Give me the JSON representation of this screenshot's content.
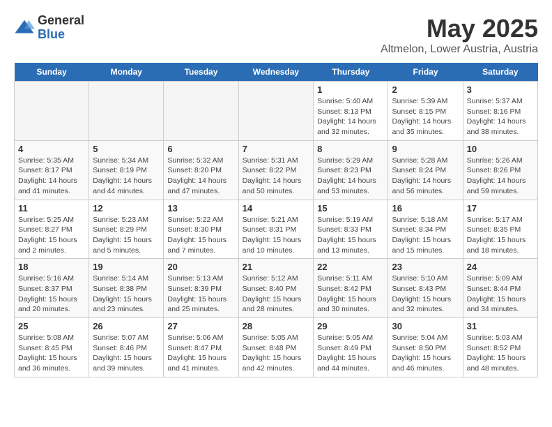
{
  "logo": {
    "general": "General",
    "blue": "Blue"
  },
  "title": "May 2025",
  "subtitle": "Altmelon, Lower Austria, Austria",
  "headers": [
    "Sunday",
    "Monday",
    "Tuesday",
    "Wednesday",
    "Thursday",
    "Friday",
    "Saturday"
  ],
  "weeks": [
    [
      {
        "day": "",
        "info": ""
      },
      {
        "day": "",
        "info": ""
      },
      {
        "day": "",
        "info": ""
      },
      {
        "day": "",
        "info": ""
      },
      {
        "day": "1",
        "info": "Sunrise: 5:40 AM\nSunset: 8:13 PM\nDaylight: 14 hours\nand 32 minutes."
      },
      {
        "day": "2",
        "info": "Sunrise: 5:39 AM\nSunset: 8:15 PM\nDaylight: 14 hours\nand 35 minutes."
      },
      {
        "day": "3",
        "info": "Sunrise: 5:37 AM\nSunset: 8:16 PM\nDaylight: 14 hours\nand 38 minutes."
      }
    ],
    [
      {
        "day": "4",
        "info": "Sunrise: 5:35 AM\nSunset: 8:17 PM\nDaylight: 14 hours\nand 41 minutes."
      },
      {
        "day": "5",
        "info": "Sunrise: 5:34 AM\nSunset: 8:19 PM\nDaylight: 14 hours\nand 44 minutes."
      },
      {
        "day": "6",
        "info": "Sunrise: 5:32 AM\nSunset: 8:20 PM\nDaylight: 14 hours\nand 47 minutes."
      },
      {
        "day": "7",
        "info": "Sunrise: 5:31 AM\nSunset: 8:22 PM\nDaylight: 14 hours\nand 50 minutes."
      },
      {
        "day": "8",
        "info": "Sunrise: 5:29 AM\nSunset: 8:23 PM\nDaylight: 14 hours\nand 53 minutes."
      },
      {
        "day": "9",
        "info": "Sunrise: 5:28 AM\nSunset: 8:24 PM\nDaylight: 14 hours\nand 56 minutes."
      },
      {
        "day": "10",
        "info": "Sunrise: 5:26 AM\nSunset: 8:26 PM\nDaylight: 14 hours\nand 59 minutes."
      }
    ],
    [
      {
        "day": "11",
        "info": "Sunrise: 5:25 AM\nSunset: 8:27 PM\nDaylight: 15 hours\nand 2 minutes."
      },
      {
        "day": "12",
        "info": "Sunrise: 5:23 AM\nSunset: 8:29 PM\nDaylight: 15 hours\nand 5 minutes."
      },
      {
        "day": "13",
        "info": "Sunrise: 5:22 AM\nSunset: 8:30 PM\nDaylight: 15 hours\nand 7 minutes."
      },
      {
        "day": "14",
        "info": "Sunrise: 5:21 AM\nSunset: 8:31 PM\nDaylight: 15 hours\nand 10 minutes."
      },
      {
        "day": "15",
        "info": "Sunrise: 5:19 AM\nSunset: 8:33 PM\nDaylight: 15 hours\nand 13 minutes."
      },
      {
        "day": "16",
        "info": "Sunrise: 5:18 AM\nSunset: 8:34 PM\nDaylight: 15 hours\nand 15 minutes."
      },
      {
        "day": "17",
        "info": "Sunrise: 5:17 AM\nSunset: 8:35 PM\nDaylight: 15 hours\nand 18 minutes."
      }
    ],
    [
      {
        "day": "18",
        "info": "Sunrise: 5:16 AM\nSunset: 8:37 PM\nDaylight: 15 hours\nand 20 minutes."
      },
      {
        "day": "19",
        "info": "Sunrise: 5:14 AM\nSunset: 8:38 PM\nDaylight: 15 hours\nand 23 minutes."
      },
      {
        "day": "20",
        "info": "Sunrise: 5:13 AM\nSunset: 8:39 PM\nDaylight: 15 hours\nand 25 minutes."
      },
      {
        "day": "21",
        "info": "Sunrise: 5:12 AM\nSunset: 8:40 PM\nDaylight: 15 hours\nand 28 minutes."
      },
      {
        "day": "22",
        "info": "Sunrise: 5:11 AM\nSunset: 8:42 PM\nDaylight: 15 hours\nand 30 minutes."
      },
      {
        "day": "23",
        "info": "Sunrise: 5:10 AM\nSunset: 8:43 PM\nDaylight: 15 hours\nand 32 minutes."
      },
      {
        "day": "24",
        "info": "Sunrise: 5:09 AM\nSunset: 8:44 PM\nDaylight: 15 hours\nand 34 minutes."
      }
    ],
    [
      {
        "day": "25",
        "info": "Sunrise: 5:08 AM\nSunset: 8:45 PM\nDaylight: 15 hours\nand 36 minutes."
      },
      {
        "day": "26",
        "info": "Sunrise: 5:07 AM\nSunset: 8:46 PM\nDaylight: 15 hours\nand 39 minutes."
      },
      {
        "day": "27",
        "info": "Sunrise: 5:06 AM\nSunset: 8:47 PM\nDaylight: 15 hours\nand 41 minutes."
      },
      {
        "day": "28",
        "info": "Sunrise: 5:05 AM\nSunset: 8:48 PM\nDaylight: 15 hours\nand 42 minutes."
      },
      {
        "day": "29",
        "info": "Sunrise: 5:05 AM\nSunset: 8:49 PM\nDaylight: 15 hours\nand 44 minutes."
      },
      {
        "day": "30",
        "info": "Sunrise: 5:04 AM\nSunset: 8:50 PM\nDaylight: 15 hours\nand 46 minutes."
      },
      {
        "day": "31",
        "info": "Sunrise: 5:03 AM\nSunset: 8:52 PM\nDaylight: 15 hours\nand 48 minutes."
      }
    ]
  ]
}
